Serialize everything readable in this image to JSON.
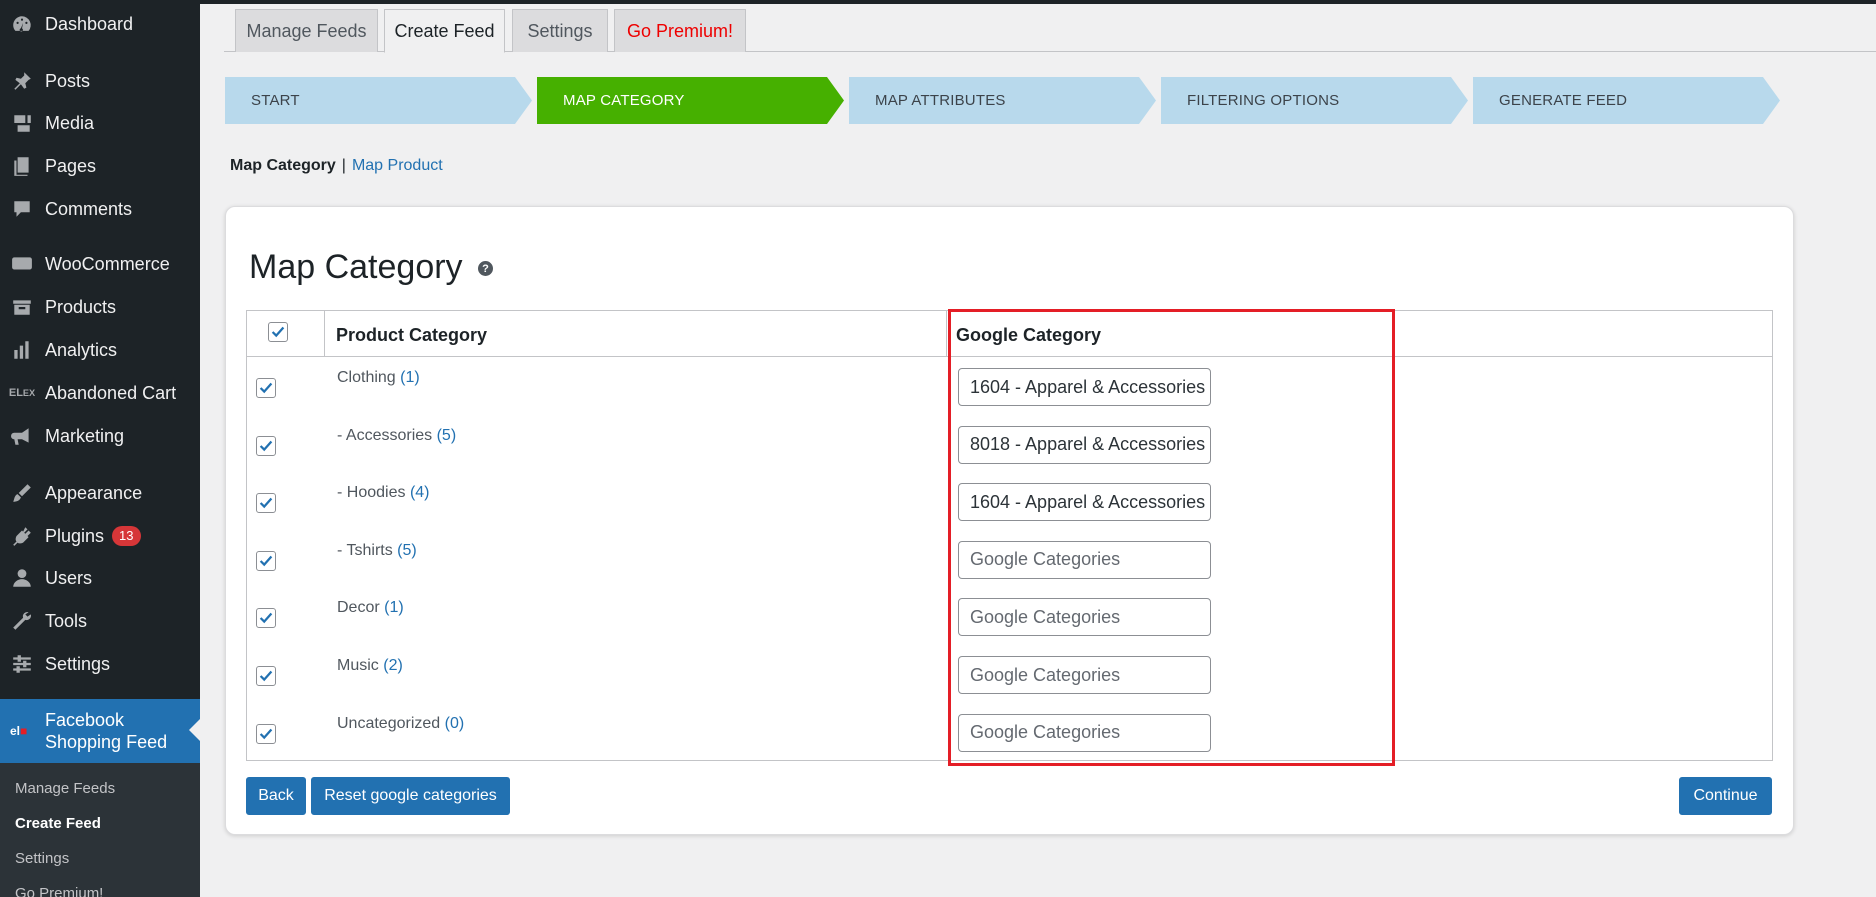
{
  "sidebar": {
    "items": [
      {
        "label": "Dashboard",
        "icon": "dashboard-icon"
      },
      {
        "label": "Posts",
        "icon": "pin-icon"
      },
      {
        "label": "Media",
        "icon": "media-icon"
      },
      {
        "label": "Pages",
        "icon": "pages-icon"
      },
      {
        "label": "Comments",
        "icon": "comment-icon"
      },
      {
        "label": "WooCommerce",
        "icon": "woo-icon"
      },
      {
        "label": "Products",
        "icon": "archive-icon"
      },
      {
        "label": "Analytics",
        "icon": "bar-chart-icon"
      },
      {
        "label": "Abandoned Cart",
        "icon": "elex-icon"
      },
      {
        "label": "Marketing",
        "icon": "megaphone-icon"
      },
      {
        "label": "Appearance",
        "icon": "brush-icon"
      },
      {
        "label": "Plugins",
        "icon": "plugin-icon",
        "badge": "13"
      },
      {
        "label": "Users",
        "icon": "user-icon"
      },
      {
        "label": "Tools",
        "icon": "wrench-icon"
      },
      {
        "label": "Settings",
        "icon": "settings-icon"
      }
    ],
    "active": {
      "label_line1": "Facebook",
      "label_line2": "Shopping Feed"
    },
    "submenu": [
      "Manage Feeds",
      "Create Feed",
      "Settings",
      "Go Premium!"
    ]
  },
  "tabs": [
    "Manage Feeds",
    "Create Feed",
    "Settings",
    "Go Premium!"
  ],
  "steps": [
    "START",
    "MAP CATEGORY",
    "MAP ATTRIBUTES",
    "FILTERING OPTIONS",
    "GENERATE FEED"
  ],
  "subnav": {
    "current": "Map Category",
    "separator": "|",
    "link": "Map Product"
  },
  "page_title": "Map Category",
  "help_glyph": "?",
  "table": {
    "headers": {
      "product": "Product Category",
      "google": "Google Category"
    },
    "rows": [
      {
        "name": "Clothing",
        "count": "(1)",
        "google": "1604 - Apparel & Accessories"
      },
      {
        "name": "- Accessories",
        "count": "(5)",
        "google": "8018 - Apparel & Accessories"
      },
      {
        "name": "- Hoodies",
        "count": "(4)",
        "google": "1604 - Apparel & Accessories"
      },
      {
        "name": "- Tshirts",
        "count": "(5)",
        "google": ""
      },
      {
        "name": "Decor",
        "count": "(1)",
        "google": ""
      },
      {
        "name": "Music",
        "count": "(2)",
        "google": ""
      },
      {
        "name": "Uncategorized",
        "count": "(0)",
        "google": ""
      }
    ],
    "placeholder": "Google Categories"
  },
  "buttons": {
    "back": "Back",
    "reset": "Reset google categories",
    "continue": "Continue"
  },
  "colors": {
    "accent": "#2271b1",
    "active_step": "#46b000",
    "inactive_step": "#b8d9ec",
    "highlight": "#e41e26",
    "premium": "#ee0000"
  }
}
